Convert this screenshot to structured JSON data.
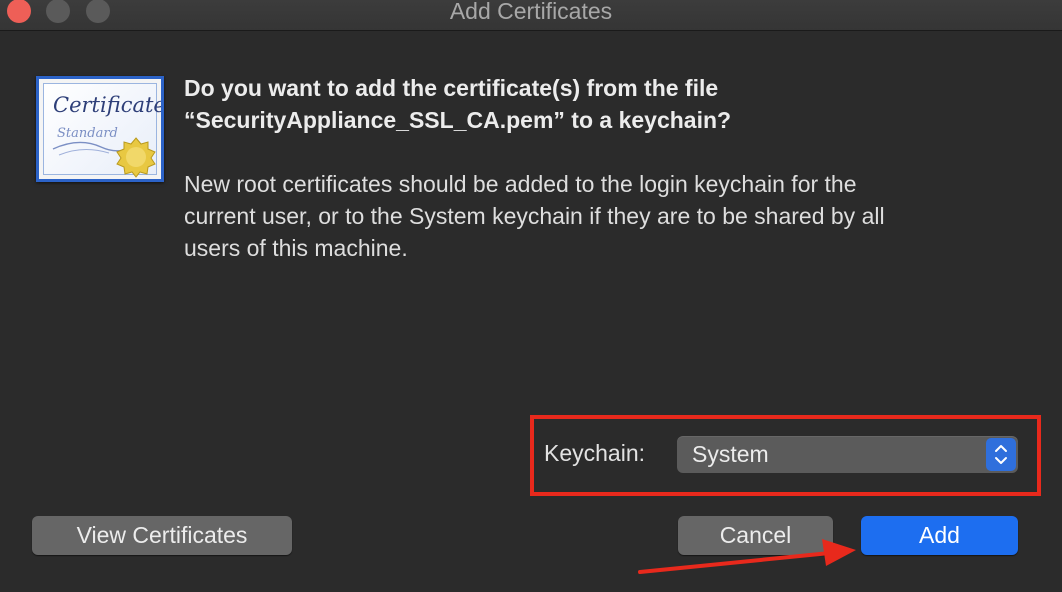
{
  "window": {
    "title": "Add Certificates"
  },
  "icon": {
    "name": "certificate-icon",
    "script_line1": "Certificate",
    "script_line2": "Standard"
  },
  "dialog": {
    "question_line1": "Do you want to add the certificate(s) from the file",
    "question_line2": "“SecurityAppliance_SSL_CA.pem” to a keychain?",
    "info_line1": "New root certificates should be added to the login keychain for the",
    "info_line2": "current user, or to the System keychain if they are to be shared by all",
    "info_line3": "users of this machine."
  },
  "keychain": {
    "label": "Keychain:",
    "selected": "System"
  },
  "buttons": {
    "view": "View Certificates",
    "cancel": "Cancel",
    "add": "Add"
  },
  "annotation": {
    "highlight_color": "#e8291c",
    "arrow_color": "#e8291c"
  }
}
